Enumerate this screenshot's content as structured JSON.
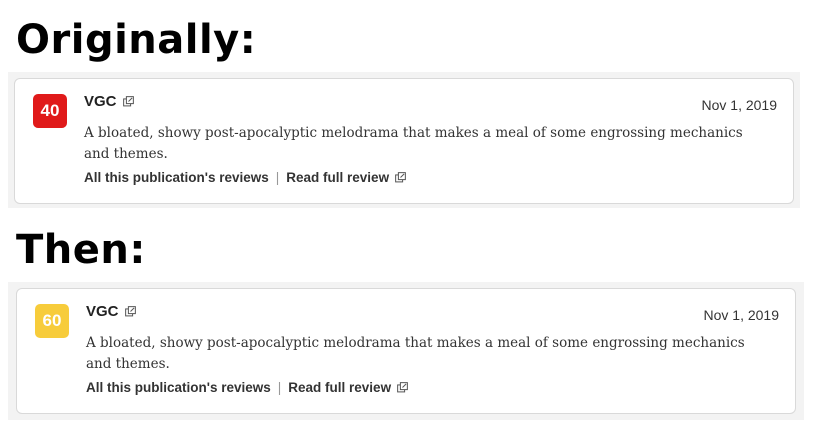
{
  "headings": {
    "first": "Originally:",
    "second": "Then:"
  },
  "reviews": [
    {
      "score": "40",
      "score_color": "#e01a1a",
      "publication": "VGC",
      "date": "Nov 1, 2019",
      "quote": "A bloated, showy post-apocalyptic melodrama that makes a meal of some engrossing mechanics and themes.",
      "all_reviews_link": "All this publication's reviews",
      "separator": "|",
      "full_review_link": "Read full review",
      "icon": "external-link-icon"
    },
    {
      "score": "60",
      "score_color": "#f7cc3b",
      "publication": "VGC",
      "date": "Nov 1, 2019",
      "quote": "A bloated, showy post-apocalyptic melodrama that makes a meal of some engrossing mechanics and themes.",
      "all_reviews_link": "All this publication's reviews",
      "separator": "|",
      "full_review_link": "Read full review",
      "icon": "external-link-icon"
    }
  ]
}
